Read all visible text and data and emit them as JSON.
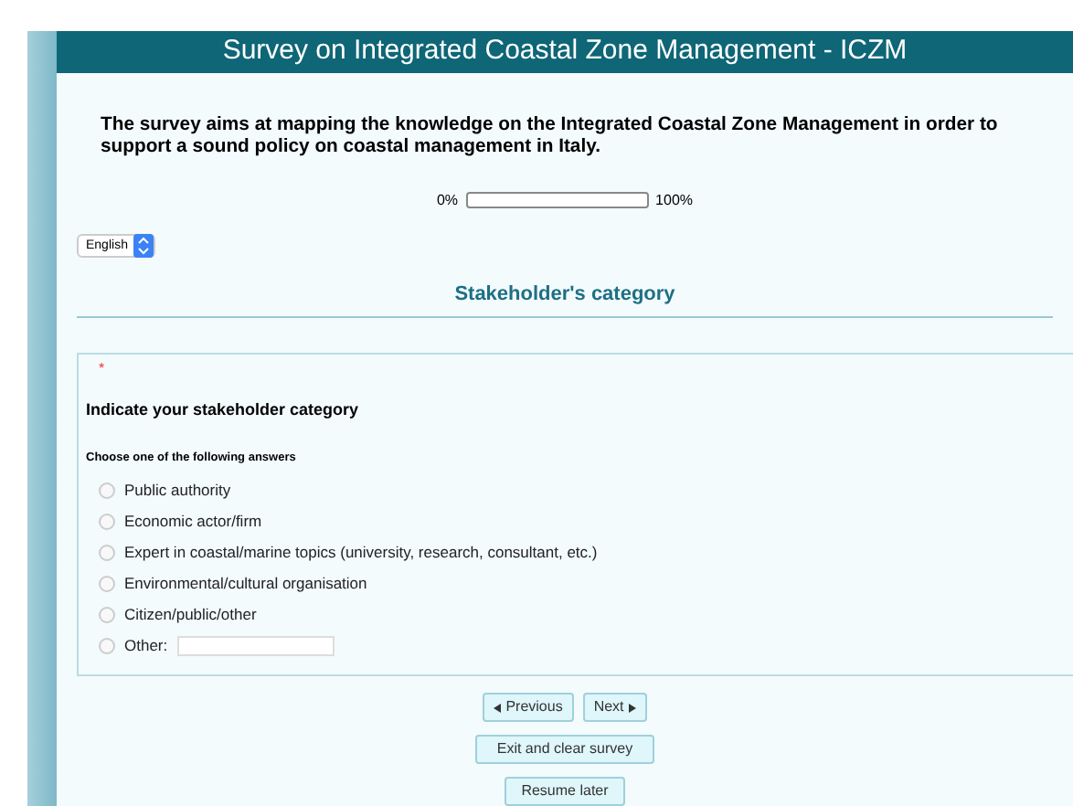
{
  "header": {
    "title": "Survey on Integrated Coastal Zone Management - ICZM"
  },
  "description": "The survey aims at mapping the knowledge on the Integrated Coastal Zone Management in order to support a sound policy on coastal management in Italy.",
  "progress": {
    "start_label": "0%",
    "end_label": "100%",
    "level": 0
  },
  "language_select": {
    "value": "English"
  },
  "group_title": "Stakeholder's category",
  "question": {
    "required_mark": "*",
    "text": "Indicate your stakeholder category",
    "help": "Choose one of the following answers",
    "options": [
      {
        "label": "Public authority",
        "selected": false,
        "kind": "plain"
      },
      {
        "label": "Economic actor/firm",
        "selected": false,
        "kind": "plain"
      },
      {
        "label": "Expert in coastal/marine topics (university, research, consultant, etc.)",
        "selected": false,
        "kind": "plain"
      },
      {
        "label": "Environmental/cultural organisation",
        "selected": false,
        "kind": "plain"
      },
      {
        "label": "Citizen/public/other",
        "selected": false,
        "kind": "plain"
      },
      {
        "label": "Other:",
        "selected": false,
        "kind": "other"
      }
    ]
  },
  "nav_buttons": [
    {
      "label": "Previous",
      "kind": "previous"
    },
    {
      "label": "Next",
      "kind": "next"
    }
  ],
  "buttons": [
    "Exit and clear survey",
    "Resume later"
  ]
}
